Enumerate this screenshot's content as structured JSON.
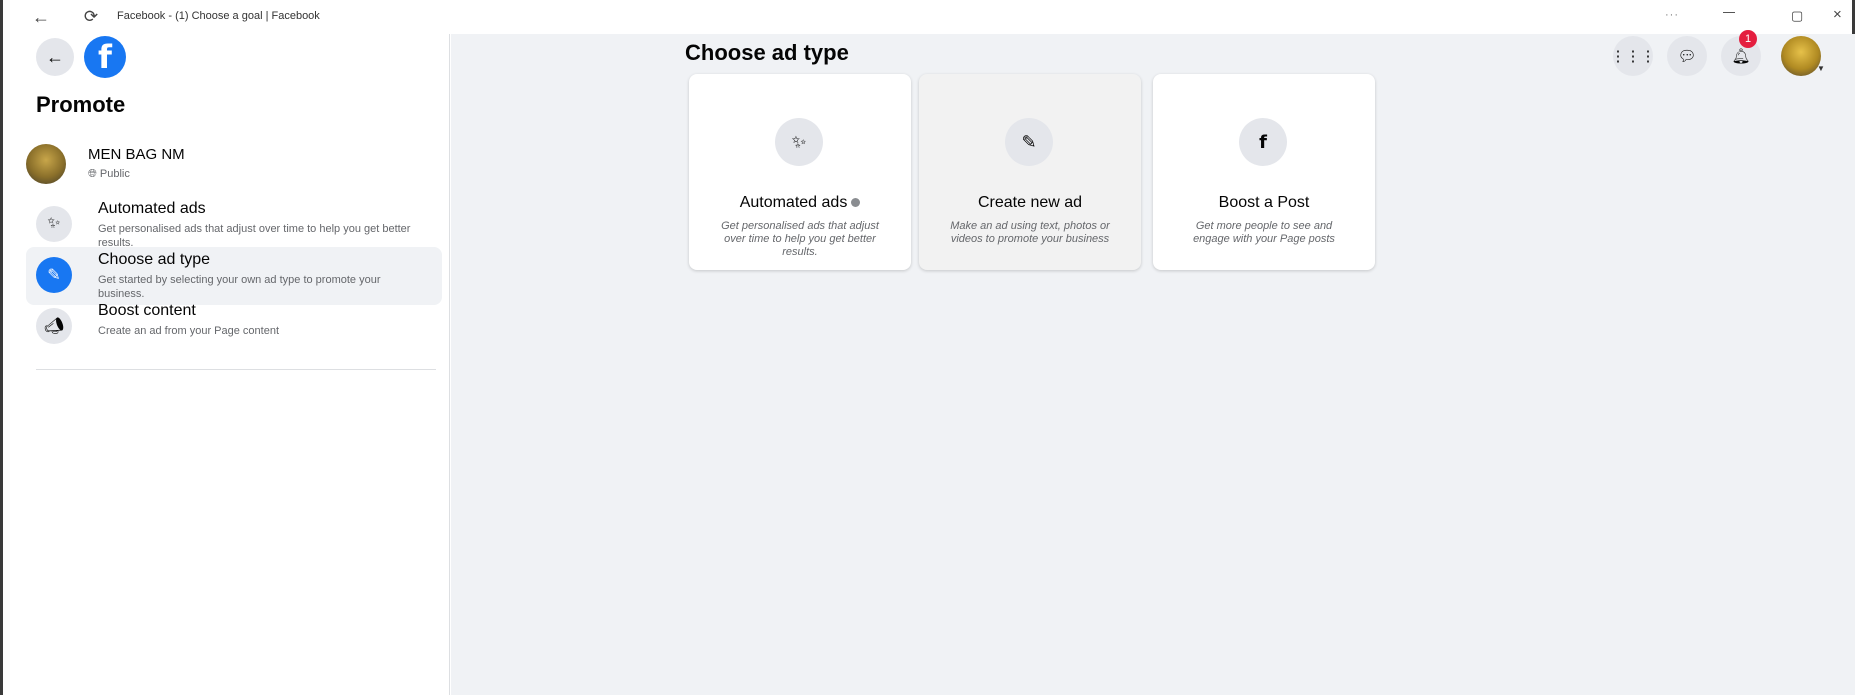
{
  "window": {
    "title": "Facebook - (1) Choose a goal | Facebook",
    "back_icon": "back-arrow-icon",
    "refresh_icon": "refresh-icon",
    "more_label": "···",
    "minimize_label": "—",
    "maximize_label": "▢",
    "close_label": "×"
  },
  "sidebar": {
    "back_icon": "back-arrow-icon",
    "logo_letter": "f",
    "title": "Promote",
    "page": {
      "name": "MEN BAG NM",
      "privacy": "Public"
    },
    "items": [
      {
        "title": "Automated ads",
        "description": "Get personalised ads that adjust over time to help you get better results.",
        "icon": "magic-wand-icon"
      },
      {
        "title": "Choose ad type",
        "description": "Get started by selecting your own ad type to promote your business.",
        "icon": "edit-icon"
      },
      {
        "title": "Boost content",
        "description": "Create an ad from your Page content",
        "icon": "megaphone-icon"
      }
    ]
  },
  "main": {
    "title": "Choose ad type",
    "cards": [
      {
        "title": "Automated ads",
        "description": "Get personalised ads that adjust over time to help you get better results.",
        "icon": "magic-wand-icon"
      },
      {
        "title": "Create new ad",
        "description": "Make an ad using text, photos or videos to promote your business",
        "icon": "edit-icon"
      },
      {
        "title": "Boost a Post",
        "description": "Get more people to see and engage with your Page posts",
        "icon": "facebook-icon"
      }
    ]
  },
  "header": {
    "notification_count": "1",
    "icons": [
      "menu-grid-icon",
      "messenger-icon",
      "bell-icon"
    ]
  },
  "colors": {
    "brand": "#1877f2",
    "background": "#f0f2f5",
    "badge": "#e41e3f"
  }
}
